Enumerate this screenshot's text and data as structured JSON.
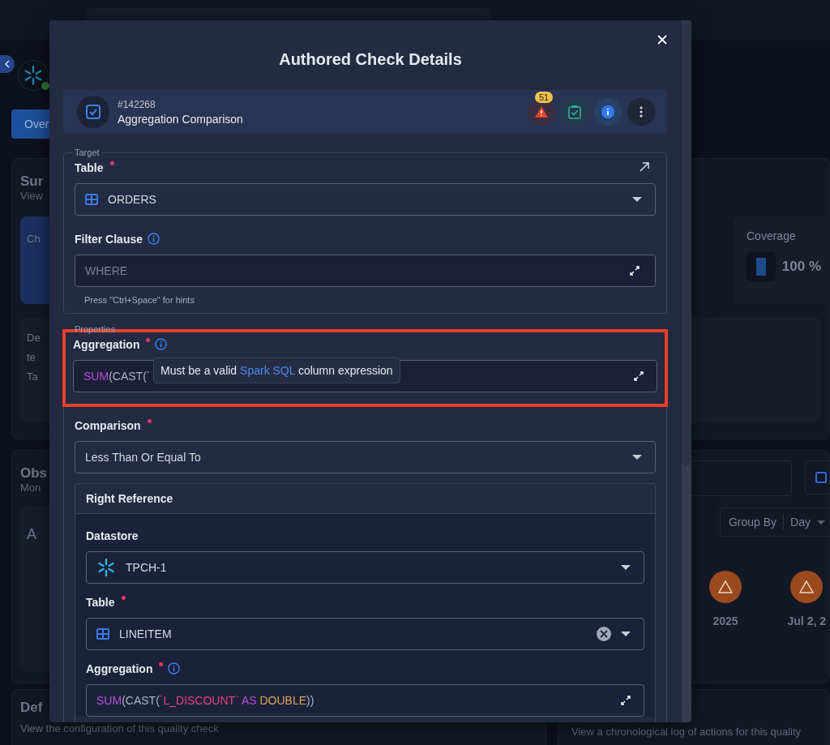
{
  "background": {
    "tab": {
      "label": "Over",
      "selected": true
    },
    "summary": {
      "title": "Sur",
      "subtitle": "View",
      "card_label": "Ch",
      "detail_lines": [
        "De",
        "te",
        "Ta"
      ],
      "coverage": {
        "label": "Coverage",
        "value": "100 %"
      }
    },
    "observability": {
      "title": "Obs",
      "subtitle": "Mon",
      "card_label": "A",
      "group_by": {
        "label": "Group By",
        "value": "Day"
      },
      "timeline": [
        {
          "date": "2025"
        },
        {
          "date": "Jul 2, 2"
        }
      ]
    },
    "definition": {
      "title": "Def",
      "subtitle": "View the configuration of this quality check"
    },
    "activity": {
      "subtitle": "View a chronological log of actions for this quality"
    }
  },
  "modal": {
    "title": "Authored Check Details",
    "check": {
      "id": "#142268",
      "name": "Aggregation Comparison",
      "anomaly_count": "51"
    },
    "target": {
      "legend": "Target",
      "table": {
        "label": "Table",
        "required": true,
        "value": "ORDERS"
      },
      "filter": {
        "label": "Filter Clause",
        "placeholder": "WHERE",
        "hint": "Press \"Ctrl+Space\" for hints"
      }
    },
    "properties": {
      "legend": "Properties",
      "aggregation": {
        "label": "Aggregation",
        "required": true,
        "tokens": [
          {
            "text": "SUM",
            "kind": "function"
          },
          {
            "text": "(CAST(`",
            "kind": "plain"
          }
        ],
        "tooltip": [
          {
            "text": "Must be a valid ",
            "kind": "plain"
          },
          {
            "text": "Spark SQL",
            "kind": "link"
          },
          {
            "text": " column expression",
            "kind": "plain"
          }
        ]
      },
      "comparison": {
        "label": "Comparison",
        "required": true,
        "value": "Less Than Or Equal To"
      },
      "right_reference": {
        "title": "Right Reference",
        "datastore": {
          "label": "Datastore",
          "required": false,
          "value": "TPCH-1"
        },
        "table": {
          "label": "Table",
          "required": true,
          "value": "LINEITEM"
        },
        "aggregation": {
          "label": "Aggregation",
          "required": true,
          "tokens": [
            {
              "text": "SUM",
              "kind": "function"
            },
            {
              "text": "(CAST(",
              "kind": "plain"
            },
            {
              "text": "`L_DISCOUNT`",
              "kind": "identifier"
            },
            {
              "text": " AS ",
              "kind": "keyword"
            },
            {
              "text": "DOUBLE",
              "kind": "type"
            },
            {
              "text": "))",
              "kind": "plain"
            }
          ]
        }
      }
    }
  }
}
